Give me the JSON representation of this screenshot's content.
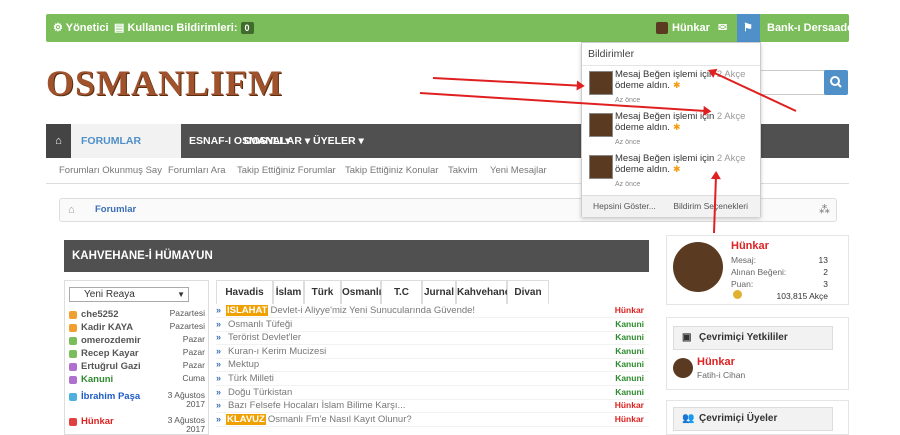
{
  "topbar": {
    "admin": "Yönetici",
    "notif_label": "Kullanıcı Bildirimleri:",
    "notif_count": "0",
    "user": "Hünkar",
    "bank": "Bank-ı Dersaadet"
  },
  "logo": "OSMANLIFM",
  "nav": {
    "items": [
      "FORUMLAR",
      "ESNAF-I OSMANLI ▾",
      "DOSYALAR ▾",
      "ÜYELER ▾"
    ]
  },
  "subnav": [
    "Forumları Okunmuş Say",
    "Forumları Ara",
    "Takip Ettiğiniz Forumlar",
    "Takip Ettiğiniz Konular",
    "Takvim",
    "Yeni Mesajlar"
  ],
  "breadcrumb": "Forumlar",
  "section_title": "KAHVEHANE-İ HÜMAYUN",
  "rank_select": "Yeni Reaya",
  "users": [
    {
      "name": "che5252",
      "day": "Pazartesi",
      "color": "#555",
      "icon": "#f0a030"
    },
    {
      "name": "Kadir KAYA",
      "day": "Pazartesi",
      "color": "#555",
      "icon": "#f0a030"
    },
    {
      "name": "omerozdemir",
      "day": "Pazar",
      "color": "#555",
      "icon": "#7cbd5b"
    },
    {
      "name": "Recep Kayar",
      "day": "Pazar",
      "color": "#555",
      "icon": "#7cbd5b"
    },
    {
      "name": "Ertuğrul Gazi",
      "day": "Pazar",
      "color": "#555",
      "icon": "#b070d0"
    },
    {
      "name": "Kanuni",
      "day": "Cuma",
      "color": "#2e8b2e",
      "icon": "#b070d0"
    },
    {
      "name": "İbrahim Paşa",
      "day": "3 Ağustos 2017",
      "color": "#1e5bc6",
      "icon": "#4fb0e0"
    },
    {
      "name": "Hünkar",
      "day": "3 Ağustos 2017",
      "color": "#d22",
      "icon": "#e04040"
    }
  ],
  "tabs": [
    "Havadis",
    "İslam",
    "Türk",
    "Osmanlı",
    "T.C",
    "Jurnal",
    "Kahvehane",
    "Divan"
  ],
  "threads": [
    {
      "tag": "ISLAHAT",
      "tagcolor": "#f0a000",
      "title": "Devlet-i Aliyye'miz Yeni Sunucularında Güvende!",
      "author": "Hünkar",
      "acolor": "#d22"
    },
    {
      "tag": "",
      "tagcolor": "",
      "title": "Osmanlı Tüfeği",
      "author": "Kanuni",
      "acolor": "#2e8b2e"
    },
    {
      "tag": "",
      "tagcolor": "",
      "title": "Terörist Devlet'ler",
      "author": "Kanuni",
      "acolor": "#2e8b2e"
    },
    {
      "tag": "",
      "tagcolor": "",
      "title": "Kuran-ı Kerim Mucizesi",
      "author": "Kanuni",
      "acolor": "#2e8b2e"
    },
    {
      "tag": "",
      "tagcolor": "",
      "title": "Mektup",
      "author": "Kanuni",
      "acolor": "#2e8b2e"
    },
    {
      "tag": "",
      "tagcolor": "",
      "title": "Türk Milleti",
      "author": "Kanuni",
      "acolor": "#2e8b2e"
    },
    {
      "tag": "",
      "tagcolor": "",
      "title": "Doğu Türkistan",
      "author": "Kanuni",
      "acolor": "#2e8b2e"
    },
    {
      "tag": "",
      "tagcolor": "",
      "title": "Bazı Felsefe Hocaları İslam Bilime Karşı...",
      "author": "Hünkar",
      "acolor": "#d22"
    },
    {
      "tag": "KLAVUZ",
      "tagcolor": "#f0a000",
      "title": "Osmanlı Fm'e Nasıl Kayıt Olunur?",
      "author": "Hünkar",
      "acolor": "#d22"
    }
  ],
  "profile": {
    "name": "Hünkar",
    "mesaj_label": "Mesaj:",
    "mesaj": "13",
    "begeni_label": "Alınan Beğeni:",
    "begeni": "2",
    "puan_label": "Puan:",
    "puan": "3",
    "akce": "103,815 Akçe"
  },
  "authorities": {
    "title": "Çevrimiçi Yetkililer",
    "name": "Hünkar",
    "role": "Fatih-i Cihan"
  },
  "online": {
    "title": "Çevrimiçi Üyeler"
  },
  "notifications": {
    "title": "Bildirimler",
    "items": [
      {
        "pre": "Mesaj Beğen işlemi için ",
        "amt": "2 Akçe",
        "post": "ödeme aldın.",
        "time": "Az önce"
      },
      {
        "pre": "Mesaj Beğen işlemi için ",
        "amt": "2 Akçe",
        "post": "ödeme aldın.",
        "time": "Az önce"
      },
      {
        "pre": "Mesaj Beğen işlemi için ",
        "amt": "2 Akçe",
        "post": "ödeme aldın.",
        "time": "Az önce"
      }
    ],
    "show_all": "Hepsini Göster...",
    "options": "Bildirim Seçenekleri"
  },
  "colors": {
    "topbar": "#7cbd5b",
    "accent": "#4f90c9",
    "nav": "#505050",
    "annotation": "#e02020"
  }
}
